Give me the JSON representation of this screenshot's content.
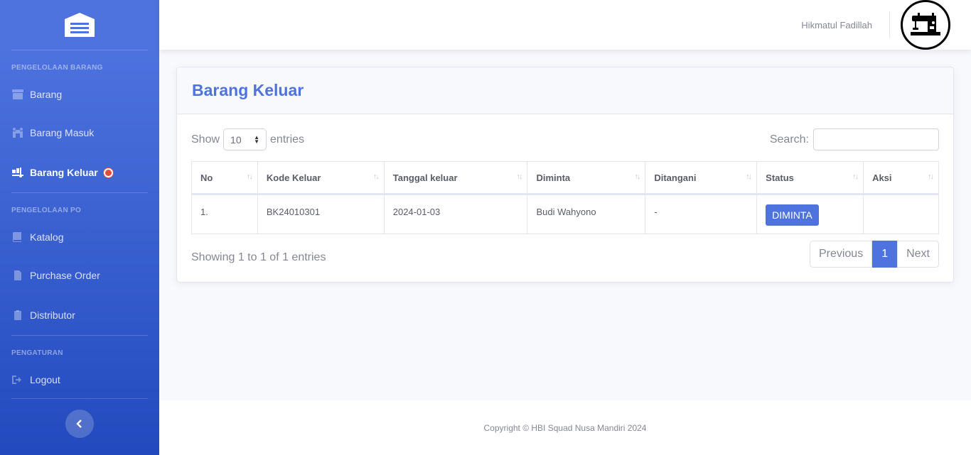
{
  "sidebar": {
    "sections": [
      {
        "heading": "PENGELOLAAN BARANG"
      },
      {
        "heading": "PENGELOLAAN PO"
      },
      {
        "heading": "PENGATURAN"
      }
    ],
    "items": [
      {
        "label": "Barang",
        "icon": "box-icon"
      },
      {
        "label": "Barang Masuk",
        "icon": "people-carry-icon"
      },
      {
        "label": "Barang Keluar",
        "icon": "truck-loading-icon",
        "active": true
      },
      {
        "label": "Katalog",
        "icon": "book-icon"
      },
      {
        "label": "Purchase Order",
        "icon": "file-invoice-icon"
      },
      {
        "label": "Distributor",
        "icon": "clipboard-icon"
      },
      {
        "label": "Logout",
        "icon": "sign-out-icon"
      }
    ]
  },
  "topbar": {
    "user_name": "Hikmatul Fadillah",
    "avatar_icon": "sewing-machine-icon"
  },
  "card": {
    "title": "Barang Keluar",
    "show_label": "Show",
    "entries_label": "entries",
    "page_length": "10",
    "search_label": "Search:",
    "search_value": ""
  },
  "table": {
    "columns": [
      "No",
      "Kode Keluar",
      "Tanggal keluar",
      "Diminta",
      "Ditangani",
      "Status",
      "Aksi"
    ],
    "rows": [
      {
        "no": "1.",
        "kode": "BK24010301",
        "tanggal": "2024-01-03",
        "diminta": "Budi Wahyono",
        "ditangani": "-",
        "status": "DIMINTA",
        "aksi": ""
      }
    ]
  },
  "pagination": {
    "info": "Showing 1 to 1 of 1 entries",
    "previous": "Previous",
    "current": "1",
    "next": "Next"
  },
  "footer": {
    "copyright": "Copyright © HBI Squad Nusa Mandiri 2024"
  },
  "colors": {
    "primary": "#4e73df",
    "sidebar_gradient_end": "#224abe",
    "badge": "#e74a3b"
  }
}
